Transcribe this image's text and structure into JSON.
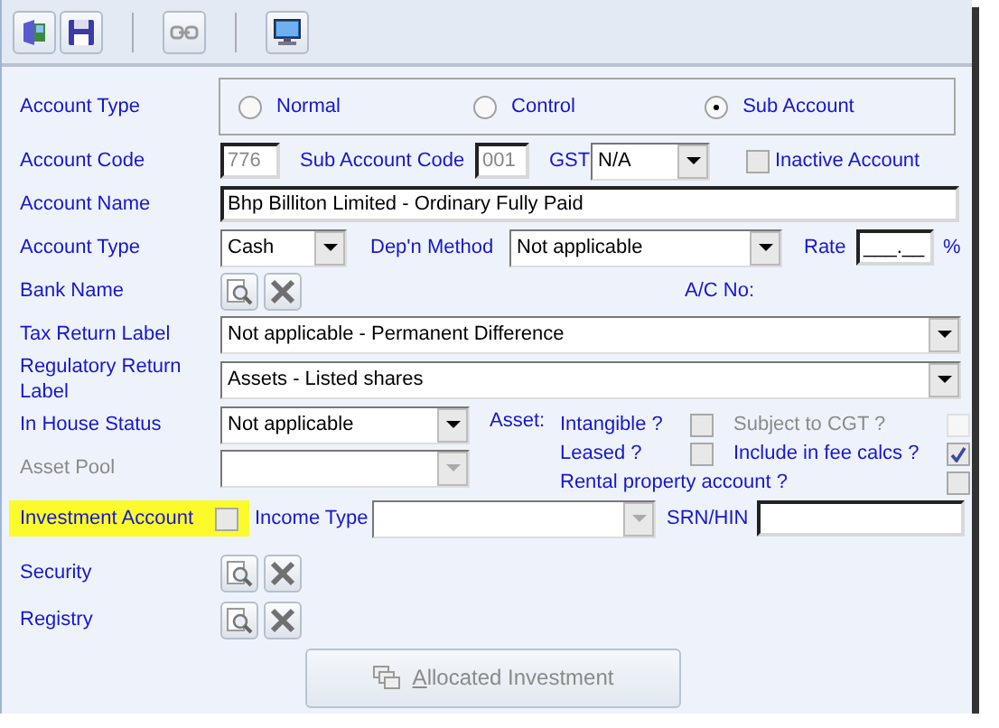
{
  "account_type_group": {
    "label": "Account Type",
    "options": [
      {
        "label": "Normal",
        "selected": false
      },
      {
        "label": "Control",
        "selected": false
      },
      {
        "label": "Sub Account",
        "selected": true
      }
    ]
  },
  "account_code": {
    "label": "Account Code",
    "value": "776",
    "disabled": true
  },
  "sub_account_code": {
    "label": "Sub Account Code",
    "value": "001",
    "disabled": true
  },
  "gst": {
    "label": "GST",
    "value": "N/A"
  },
  "inactive_account": {
    "label": "Inactive Account",
    "checked": false
  },
  "account_name": {
    "label": "Account Name",
    "value": "Bhp Billiton Limited - Ordinary Fully Paid"
  },
  "account_type": {
    "label": "Account Type",
    "value": "Cash"
  },
  "depn_method": {
    "label": "Dep'n Method",
    "value": "Not applicable"
  },
  "rate": {
    "label": "Rate",
    "value": "___.__",
    "unit": "%"
  },
  "bank_name": {
    "label": "Bank Name"
  },
  "ac_no": {
    "label": "A/C No:"
  },
  "tax_return_label": {
    "label": "Tax Return Label",
    "value": "Not applicable - Permanent Difference"
  },
  "regulatory_return_label": {
    "label": "Regulatory Return Label",
    "value": "Assets - Listed shares"
  },
  "in_house_status": {
    "label": "In House Status",
    "value": "Not applicable"
  },
  "asset_label": "Asset:",
  "asset_flags": [
    {
      "label": "Intangible ?",
      "checked": false,
      "disabled": false
    },
    {
      "label": "Subject to CGT ?",
      "checked": false,
      "disabled": true
    },
    {
      "label": "Leased ?",
      "checked": false,
      "disabled": false
    },
    {
      "label": "Include in fee calcs ?",
      "checked": true,
      "disabled": false
    },
    {
      "label": "Rental property account ?",
      "checked": false,
      "disabled": false
    }
  ],
  "asset_pool": {
    "label": "Asset Pool",
    "disabled": true
  },
  "investment_account": {
    "label": "Investment Account",
    "checked": false,
    "highlighted": true
  },
  "income_type": {
    "label": "Income Type",
    "disabled": true
  },
  "srn_hin": {
    "label": "SRN/HIN"
  },
  "security": {
    "label": "Security"
  },
  "registry": {
    "label": "Registry"
  },
  "allocated_button": {
    "label": "Allocated Investment",
    "disabled": true
  }
}
